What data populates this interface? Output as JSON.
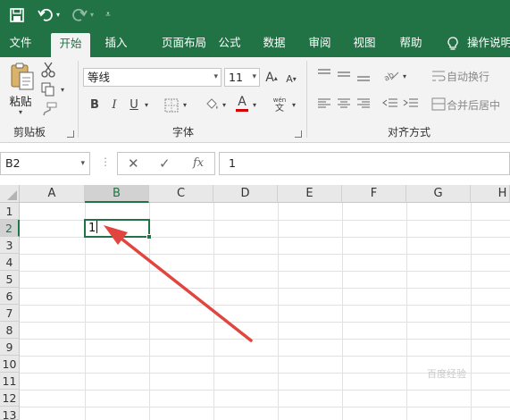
{
  "tabs": {
    "file": "文件",
    "home": "开始",
    "insert": "插入",
    "page_layout": "页面布局",
    "formulas": "公式",
    "data": "数据",
    "review": "审阅",
    "view": "视图",
    "help": "帮助",
    "tell_me": "操作说明"
  },
  "ribbon": {
    "clipboard": {
      "paste_label": "粘贴",
      "group_label": "剪贴板"
    },
    "font": {
      "font_name": "等线",
      "font_size": "11",
      "bold": "B",
      "italic": "I",
      "underline": "U",
      "grow": "A",
      "shrink": "A",
      "font_color": "A",
      "phonetic_top": "wén",
      "phonetic_bottom": "文",
      "group_label": "字体",
      "font_color_hex": "#d40000"
    },
    "alignment": {
      "wrap_text": "自动换行",
      "merge_center": "合并后居中",
      "group_label": "对齐方式"
    }
  },
  "formula_bar": {
    "name_box": "B2",
    "cancel": "✕",
    "enter": "✓",
    "function": "fx",
    "content": "1"
  },
  "sheet": {
    "columns": [
      "A",
      "B",
      "C",
      "D",
      "E",
      "F",
      "G",
      "H"
    ],
    "rows": [
      "1",
      "2",
      "3",
      "4",
      "5",
      "6",
      "7",
      "8",
      "9",
      "10",
      "11",
      "12",
      "13"
    ],
    "active_cell": "B2",
    "active_cell_value": "1"
  },
  "annotation": {
    "arrow_color": "#e0463f"
  },
  "colors": {
    "accent": "#217346"
  },
  "watermark": "百度经验"
}
